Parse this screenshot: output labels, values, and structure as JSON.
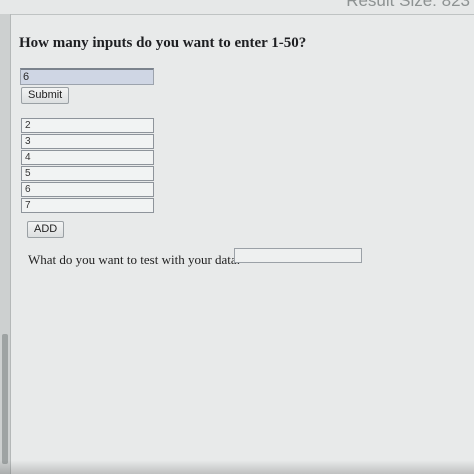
{
  "header": {
    "result_size_text": "Result Size: 823"
  },
  "form": {
    "question": "How many inputs do you want to enter 1-50?",
    "count_value": "6",
    "submit_label": "Submit"
  },
  "inputs": [
    "2",
    "3",
    "4",
    "5",
    "6",
    "7"
  ],
  "add_label": "ADD",
  "test": {
    "label": "What do you want to test with your data:",
    "value": ""
  }
}
